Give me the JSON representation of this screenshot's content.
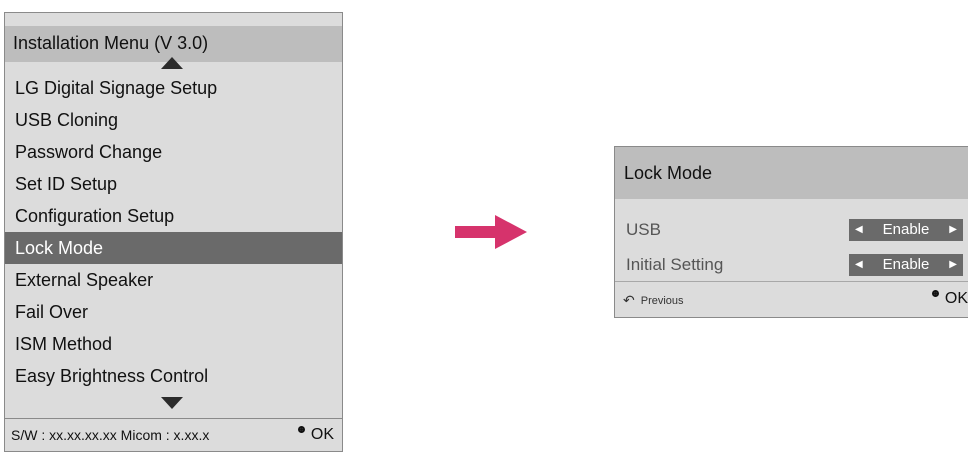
{
  "install_menu": {
    "title": "Installation Menu (V 3.0)",
    "items": [
      {
        "label": "LG Digital Signage Setup"
      },
      {
        "label": "USB Cloning"
      },
      {
        "label": "Password Change"
      },
      {
        "label": "Set ID Setup"
      },
      {
        "label": "Configuration Setup"
      },
      {
        "label": "Lock Mode",
        "selected": true
      },
      {
        "label": "External Speaker"
      },
      {
        "label": "Fail Over"
      },
      {
        "label": "ISM Method"
      },
      {
        "label": "Easy Brightness Control"
      }
    ],
    "footer_info": "S/W : xx.xx.xx.xx Micom : x.xx.x",
    "ok_label": "OK",
    "arrow_up_icon": "triangle-up-icon",
    "arrow_down_icon": "triangle-down-icon"
  },
  "transition_icon": "right-arrow-icon",
  "accent_color": "#d6336c",
  "lock_mode_dialog": {
    "title": "Lock Mode",
    "settings": [
      {
        "label": "USB",
        "value": "Enable"
      },
      {
        "label": "Initial Setting",
        "value": "Enable"
      }
    ],
    "previous_label": "Previous",
    "ok_label": "OK"
  }
}
